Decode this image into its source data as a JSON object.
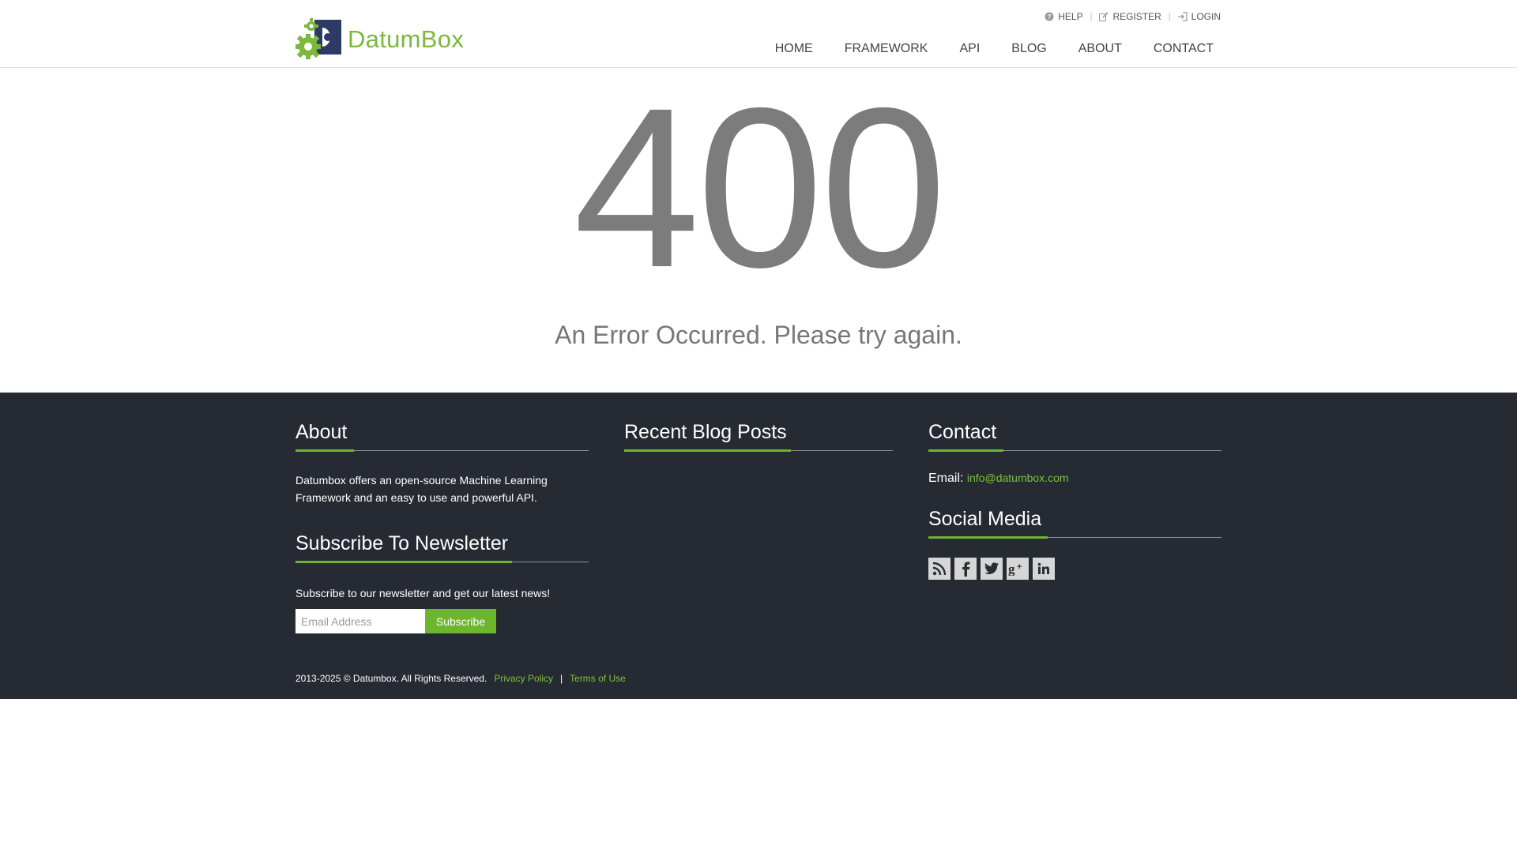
{
  "header": {
    "brand": "DatumBox",
    "top_links": [
      {
        "label": "HELP",
        "icon": "help-icon"
      },
      {
        "label": "REGISTER",
        "icon": "edit-icon"
      },
      {
        "label": "LOGIN",
        "icon": "login-icon"
      }
    ],
    "nav": [
      "HOME",
      "FRAMEWORK",
      "API",
      "BLOG",
      "ABOUT",
      "CONTACT"
    ]
  },
  "error": {
    "code": "400",
    "message": "An Error Occurred. Please try again."
  },
  "footer": {
    "about": {
      "heading": "About",
      "text": "Datumbox offers an open-source Machine Learning Framework and an easy to use and powerful API."
    },
    "newsletter": {
      "heading": "Subscribe To Newsletter",
      "text": "Subscribe to our newsletter and get our latest news!",
      "placeholder": "Email Address",
      "button": "Subscribe"
    },
    "blog": {
      "heading": "Recent Blog Posts"
    },
    "contact": {
      "heading": "Contact",
      "email_label": "Email:",
      "email": "info@datumbox.com"
    },
    "social": {
      "heading": "Social Media",
      "icons": [
        "rss-icon",
        "facebook-icon",
        "twitter-icon",
        "google-plus-icon",
        "linkedin-icon"
      ]
    },
    "copyright": "2013-2025 © Datumbox. All Rights Reserved.",
    "privacy": "Privacy Policy",
    "separator": "|",
    "terms": "Terms of Use"
  },
  "colors": {
    "brand_green": "#7cb83e",
    "accent_green": "#6cb52d",
    "footer_bg": "#262a33",
    "error_gray": "#7c7c7c"
  }
}
